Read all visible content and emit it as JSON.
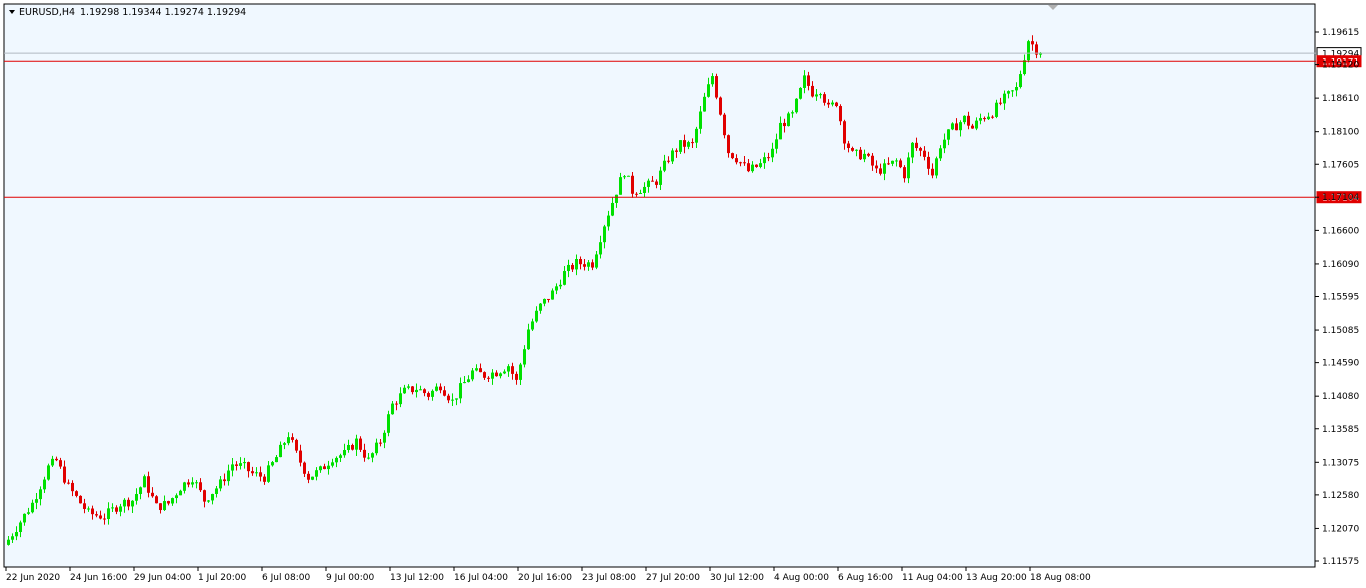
{
  "header": {
    "menu_icon": "triangle-down-icon",
    "symbol": "EURUSD,H4",
    "ohlc": "1.19298 1.19344 1.19274 1.19294"
  },
  "colors": {
    "background": "#f0f8ff",
    "frame": "#000000",
    "bull": "#00e000",
    "bear": "#e00000",
    "hline": "#e00000",
    "bid_line": "#b0b8c0"
  },
  "chart_data": {
    "type": "candlestick",
    "title": "",
    "ylim": [
      1.11575,
      1.19615
    ],
    "y_ticks": [
      "1.19615",
      "1.19120",
      "1.18610",
      "1.18100",
      "1.17605",
      "1.17104",
      "1.16600",
      "1.16090",
      "1.15595",
      "1.15085",
      "1.14590",
      "1.14080",
      "1.13585",
      "1.13075",
      "1.12580",
      "1.12070",
      "1.11575"
    ],
    "x_ticks": [
      "22 Jun 2020",
      "24 Jun 16:00",
      "29 Jun 04:00",
      "1 Jul 20:00",
      "6 Jul 08:00",
      "9 Jul 00:00",
      "13 Jul 12:00",
      "16 Jul 04:00",
      "20 Jul 16:00",
      "23 Jul 08:00",
      "27 Jul 20:00",
      "30 Jul 12:00",
      "4 Aug 00:00",
      "6 Aug 16:00",
      "11 Aug 04:00",
      "13 Aug 20:00",
      "18 Aug 08:00"
    ],
    "trend_path": [
      [
        0,
        1.119
      ],
      [
        6,
        1.1245
      ],
      [
        10,
        1.13
      ],
      [
        12,
        1.131
      ],
      [
        15,
        1.127
      ],
      [
        20,
        1.123
      ],
      [
        24,
        1.1225
      ],
      [
        28,
        1.1245
      ],
      [
        31,
        1.125
      ],
      [
        34,
        1.128
      ],
      [
        37,
        1.124
      ],
      [
        40,
        1.1245
      ],
      [
        43,
        1.127
      ],
      [
        46,
        1.1285
      ],
      [
        49,
        1.125
      ],
      [
        53,
        1.1275
      ],
      [
        56,
        1.1305
      ],
      [
        59,
        1.13
      ],
      [
        61,
        1.129
      ],
      [
        64,
        1.1285
      ],
      [
        67,
        1.1315
      ],
      [
        70,
        1.135
      ],
      [
        72,
        1.132
      ],
      [
        75,
        1.1285
      ],
      [
        78,
        1.1295
      ],
      [
        81,
        1.1315
      ],
      [
        84,
        1.132
      ],
      [
        87,
        1.134
      ],
      [
        90,
        1.131
      ],
      [
        93,
        1.134
      ],
      [
        96,
        1.1395
      ],
      [
        99,
        1.1415
      ],
      [
        102,
        1.142
      ],
      [
        105,
        1.141
      ],
      [
        108,
        1.1425
      ],
      [
        111,
        1.14
      ],
      [
        113,
        1.142
      ],
      [
        116,
        1.1445
      ],
      [
        119,
        1.144
      ],
      [
        122,
        1.1445
      ],
      [
        125,
        1.1455
      ],
      [
        127,
        1.143
      ],
      [
        130,
        1.151
      ],
      [
        133,
        1.1545
      ],
      [
        136,
        1.1565
      ],
      [
        139,
        1.1595
      ],
      [
        142,
        1.161
      ],
      [
        146,
        1.161
      ],
      [
        149,
        1.167
      ],
      [
        152,
        1.172
      ],
      [
        154,
        1.175
      ],
      [
        156,
        1.172
      ],
      [
        159,
        1.1725
      ],
      [
        162,
        1.1735
      ],
      [
        165,
        1.177
      ],
      [
        168,
        1.179
      ],
      [
        171,
        1.179
      ],
      [
        174,
        1.186
      ],
      [
        176,
        1.1895
      ],
      [
        178,
        1.184
      ],
      [
        180,
        1.178
      ],
      [
        182,
        1.177
      ],
      [
        185,
        1.175
      ],
      [
        188,
        1.176
      ],
      [
        191,
        1.178
      ],
      [
        193,
        1.182
      ],
      [
        196,
        1.1835
      ],
      [
        199,
        1.189
      ],
      [
        201,
        1.187
      ],
      [
        203,
        1.1875
      ],
      [
        205,
        1.1845
      ],
      [
        207,
        1.1855
      ],
      [
        209,
        1.18
      ],
      [
        211,
        1.1775
      ],
      [
        214,
        1.1775
      ],
      [
        217,
        1.175
      ],
      [
        219,
        1.1755
      ],
      [
        222,
        1.1765
      ],
      [
        224,
        1.1745
      ],
      [
        226,
        1.179
      ],
      [
        229,
        1.1775
      ],
      [
        231,
        1.1745
      ],
      [
        233,
        1.179
      ],
      [
        236,
        1.1815
      ],
      [
        239,
        1.183
      ],
      [
        241,
        1.1815
      ],
      [
        243,
        1.183
      ],
      [
        246,
        1.184
      ],
      [
        249,
        1.186
      ],
      [
        252,
        1.1875
      ],
      [
        254,
        1.1925
      ],
      [
        255,
        1.195
      ],
      [
        257,
        1.1935
      ],
      [
        258,
        1.19294
      ]
    ],
    "horizontal_lines": [
      {
        "price": 1.19294,
        "label": "1.19294",
        "kind": "bid"
      },
      {
        "price": 1.19171,
        "label": "1.19171",
        "kind": "level"
      },
      {
        "price": 1.17104,
        "label": "1.17104",
        "kind": "level"
      }
    ]
  }
}
